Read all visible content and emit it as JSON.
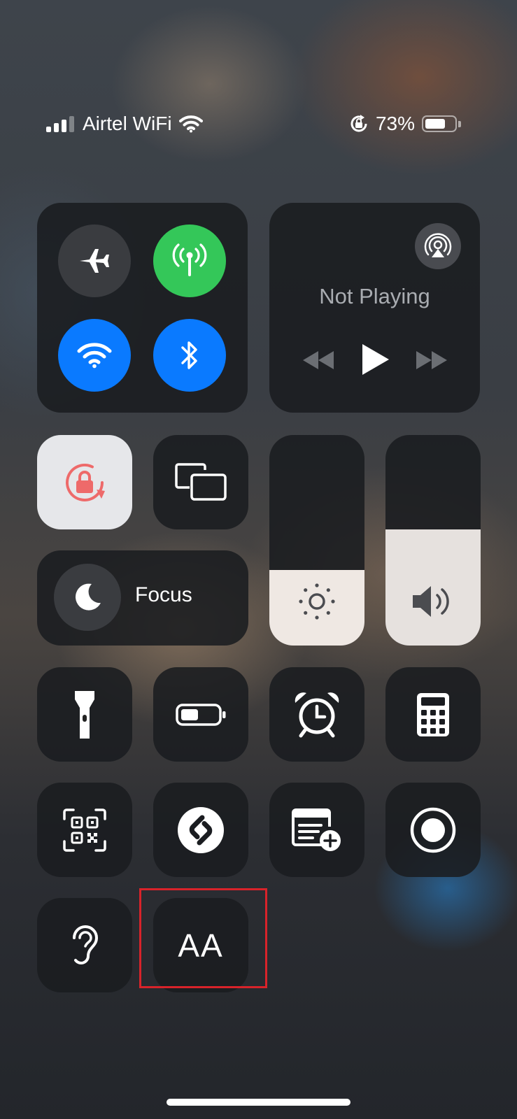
{
  "status_bar": {
    "carrier": "Airtel WiFi",
    "battery_percent": "73%",
    "battery_level": 0.73,
    "icons": [
      "cellular-signal-icon",
      "wifi-icon",
      "rotation-lock-icon",
      "battery-icon"
    ]
  },
  "connectivity": {
    "airplane_mode": "off",
    "cellular_data": "on",
    "wifi": "on",
    "bluetooth": "on",
    "colors": {
      "green": "#34c759",
      "blue": "#0a7aff",
      "off": "#3a3c40"
    }
  },
  "now_playing": {
    "title": "Not Playing",
    "icons": [
      "airplay-icon",
      "rewind-icon",
      "play-icon",
      "fast-forward-icon"
    ]
  },
  "toggles": {
    "orientation_lock": "on",
    "screen_mirroring": "off",
    "orientation_lock_color": "#ee6a6a"
  },
  "focus": {
    "label": "Focus",
    "icon": "moon-icon"
  },
  "sliders": {
    "brightness_level": 0.36,
    "volume_level": 0.55
  },
  "controls": {
    "row1": [
      "flashlight-icon",
      "low-power-mode-icon",
      "alarm-clock-icon",
      "calculator-icon"
    ],
    "row2": [
      "qr-code-scanner-icon",
      "shazam-icon",
      "quick-note-icon",
      "screen-recording-icon"
    ],
    "row3": [
      "hearing-icon",
      "text-size-icon"
    ],
    "text_size_glyph": "AA"
  },
  "annotation": {
    "highlight_color": "#d8232a"
  }
}
